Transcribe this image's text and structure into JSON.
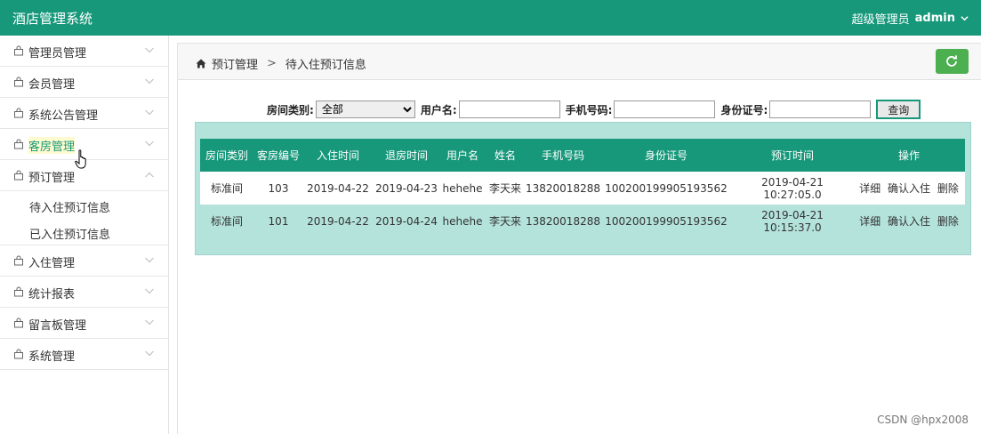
{
  "app": {
    "title": "酒店管理系统",
    "role": "超级管理员",
    "username": "admin"
  },
  "sidebar": {
    "items": [
      {
        "label": "管理员管理"
      },
      {
        "label": "会员管理"
      },
      {
        "label": "系统公告管理"
      },
      {
        "label": "客房管理"
      },
      {
        "label": "预订管理"
      },
      {
        "label": "入住管理"
      },
      {
        "label": "统计报表"
      },
      {
        "label": "留言板管理"
      },
      {
        "label": "系统管理"
      }
    ],
    "subitems": [
      {
        "label": "待入住预订信息"
      },
      {
        "label": "已入住预订信息"
      }
    ]
  },
  "breadcrumb": {
    "parent": "预订管理",
    "separator": ">",
    "current": "待入住预订信息"
  },
  "search": {
    "room_type_label": "房间类别:",
    "room_type_value": "全部",
    "username_label": "用户名:",
    "phone_label": "手机号码:",
    "idcard_label": "身份证号:",
    "button_label": "查询"
  },
  "table": {
    "headers": [
      "房间类别",
      "客房编号",
      "入住时间",
      "退房时间",
      "用户名",
      "姓名",
      "手机号码",
      "身份证号",
      "预订时间",
      "操作"
    ],
    "rows": [
      {
        "cells": [
          "标准间",
          "103",
          "2019-04-22",
          "2019-04-23",
          "hehehe",
          "李天来",
          "13820018288",
          "100200199905193562",
          "2019-04-21 10:27:05.0"
        ],
        "actions": [
          "详细",
          "确认入住",
          "删除"
        ]
      },
      {
        "cells": [
          "标准间",
          "101",
          "2019-04-22",
          "2019-04-24",
          "hehehe",
          "李天来",
          "13820018288",
          "100200199905193562",
          "2019-04-21 10:15:37.0"
        ],
        "actions": [
          "详细",
          "确认入住",
          "删除"
        ]
      }
    ]
  },
  "watermark": "CSDN @hpx2008",
  "colors": {
    "brand": "#17987a",
    "table_bg": "#b4e3dc",
    "refresh": "#4caf50"
  }
}
